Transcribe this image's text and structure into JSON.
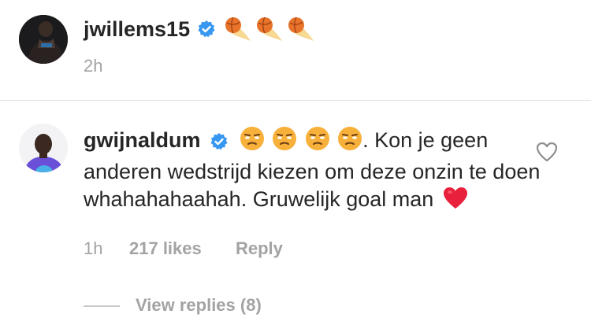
{
  "post": {
    "username": "jwillems15",
    "time": "2h"
  },
  "comment": {
    "username": "gwijnaldum",
    "text_after_emojis": ". Kon je geen",
    "text_body": "anderen wedstrijd kiezen om deze onzin te doen whahahahaahah. Gruwelijk goal man",
    "time": "1h",
    "likes": "217 likes",
    "reply_label": "Reply",
    "view_replies": "View replies (8)"
  },
  "icons": {
    "verified": "verified-badge-icon",
    "fire_ball": "flaming-basketball-icon",
    "unamused": "unamused-face-emoji",
    "heart_emoji": "red-heart-emoji",
    "like_button": "heart-outline-icon"
  },
  "colors": {
    "verified_blue": "#3897f0",
    "text": "#262626",
    "muted": "#a3a3a3",
    "heart_red": "#e8203b"
  }
}
